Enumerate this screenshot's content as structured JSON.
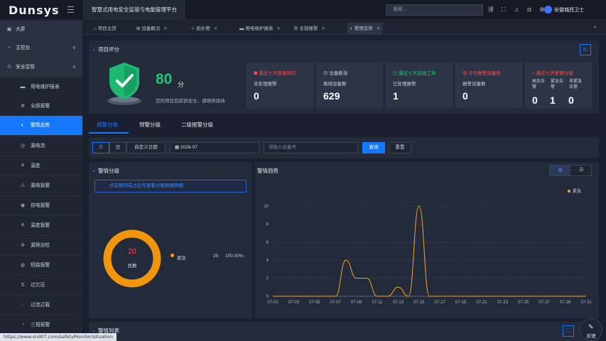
{
  "header": {
    "logo": "Dunsys",
    "app_title": "智慧式用电安全监管与电能管理平台",
    "search_placeholder": "搜索...",
    "user_name": "安徽城西卫士",
    "icons": [
      "translate-icon",
      "fullscreen-icon",
      "bell-icon",
      "lock-icon",
      "settings-icon"
    ]
  },
  "sidebar": {
    "items": [
      {
        "label": "大屏",
        "icon": "screen-icon"
      },
      {
        "label": "主控台",
        "icon": "console-icon",
        "chevron": "∨"
      },
      {
        "label": "安全监管",
        "icon": "shield-icon",
        "chevron": "∧"
      }
    ],
    "sub_items": [
      {
        "label": "用电维护报表",
        "icon": "report-icon"
      },
      {
        "label": "全部报警",
        "icon": "alarm-icon"
      },
      {
        "label": "警情态势",
        "icon": "trend-icon",
        "active": true
      },
      {
        "label": "漏电流",
        "icon": "leak-icon"
      },
      {
        "label": "温度",
        "icon": "temperature-icon"
      },
      {
        "label": "漏电报警",
        "icon": "leak-alarm-icon"
      },
      {
        "label": "窃电报警",
        "icon": "theft-icon"
      },
      {
        "label": "温度报警",
        "icon": "temp-alarm-icon"
      },
      {
        "label": "漏保自检",
        "icon": "selfcheck-icon"
      },
      {
        "label": "短路报警",
        "icon": "short-icon"
      },
      {
        "label": "过欠压",
        "icon": "voltage-icon"
      },
      {
        "label": "过流过载",
        "icon": "overload-icon"
      },
      {
        "label": "三相报警",
        "icon": "phase-icon"
      }
    ]
  },
  "tabs": [
    {
      "label": "项目主页",
      "closable": false
    },
    {
      "label": "设备概况",
      "closable": true
    },
    {
      "label": "拓扑图",
      "closable": true
    },
    {
      "label": "用电维护报表",
      "closable": true
    },
    {
      "label": "全部报警",
      "closable": true
    },
    {
      "label": "警情态势",
      "closable": true,
      "active": true
    }
  ],
  "score": {
    "title": "项目评分",
    "value": "80",
    "unit": "分",
    "note": "您的项目目前很安全，请继续保持"
  },
  "cards": [
    {
      "title": "最近七天隐患风险",
      "subtitle": "未处理报警",
      "value": "0",
      "color": "#ff4d4f"
    },
    {
      "title": "设备断连",
      "subtitle": "离线设备数",
      "value": "629",
      "color": "#c8d0dc"
    },
    {
      "title": "最近七天运维工单",
      "subtitle": "已处理报警",
      "value": "1",
      "color": "#21c37a"
    },
    {
      "title": "今日报警设备数",
      "subtitle": "报警设备数",
      "value": "0",
      "color": "#ff4d4f"
    },
    {
      "title": "最近七天警情分级",
      "subs": [
        "高危告警",
        "紧急告警",
        "非紧急告警"
      ],
      "values": [
        "0",
        "1",
        "0"
      ],
      "color": "#ff4d4f"
    }
  ],
  "subtabs": [
    "报警分级",
    "预警分级",
    "二级报警分级"
  ],
  "filters": {
    "period_buttons": [
      "月",
      "日",
      "自定义日期"
    ],
    "date_value": "2026-07",
    "device_placeholder": "请输入设备号",
    "query_label": "查询",
    "reset_label": "重置"
  },
  "alarm_level": {
    "title": "警情分级",
    "notice": "点击图例或占比可查看分级数据明细",
    "total_value": "20",
    "total_label": "总数",
    "legend": [
      {
        "name": "紧急",
        "count": "20",
        "percent": "100.00%",
        "color": "#ff9f0a"
      }
    ]
  },
  "trend": {
    "title": "警情趋势",
    "legend_name": "紧急",
    "next_section_title": "警情列表"
  },
  "chart_data": {
    "type": "line",
    "x": [
      "07-01",
      "07-02",
      "07-03",
      "07-04",
      "07-05",
      "07-06",
      "07-07",
      "07-08",
      "07-09",
      "07-10",
      "07-11",
      "07-12",
      "07-13",
      "07-14",
      "07-15",
      "07-16",
      "07-17",
      "07-18",
      "07-19",
      "07-20",
      "07-21",
      "07-22",
      "07-23",
      "07-24",
      "07-25",
      "07-26",
      "07-27",
      "07-28",
      "07-29",
      "07-30",
      "07-31"
    ],
    "x_tick_labels": [
      "07-01",
      "07-03",
      "07-05",
      "07-07",
      "07-09",
      "07-11",
      "07-13",
      "07-15",
      "07-17",
      "07-19",
      "07-21",
      "07-23",
      "07-25",
      "07-27",
      "07-29",
      "07-31"
    ],
    "series": [
      {
        "name": "紧急",
        "color": "#f5a623",
        "values": [
          0,
          0,
          0,
          0,
          0,
          0,
          0,
          4,
          2,
          2,
          0,
          0,
          1,
          0,
          10,
          0,
          0,
          0,
          0,
          0,
          0,
          0,
          0,
          0,
          0,
          0,
          0,
          0,
          0,
          0,
          0
        ]
      }
    ],
    "ylim": [
      0,
      10
    ],
    "y_ticks": [
      0,
      2,
      4,
      6,
      8,
      10
    ],
    "grid": true,
    "legend_position": "top-right"
  },
  "status_url": "https://www.snd07.com/safetyMonitor/situation",
  "feedback_label": "反馈"
}
